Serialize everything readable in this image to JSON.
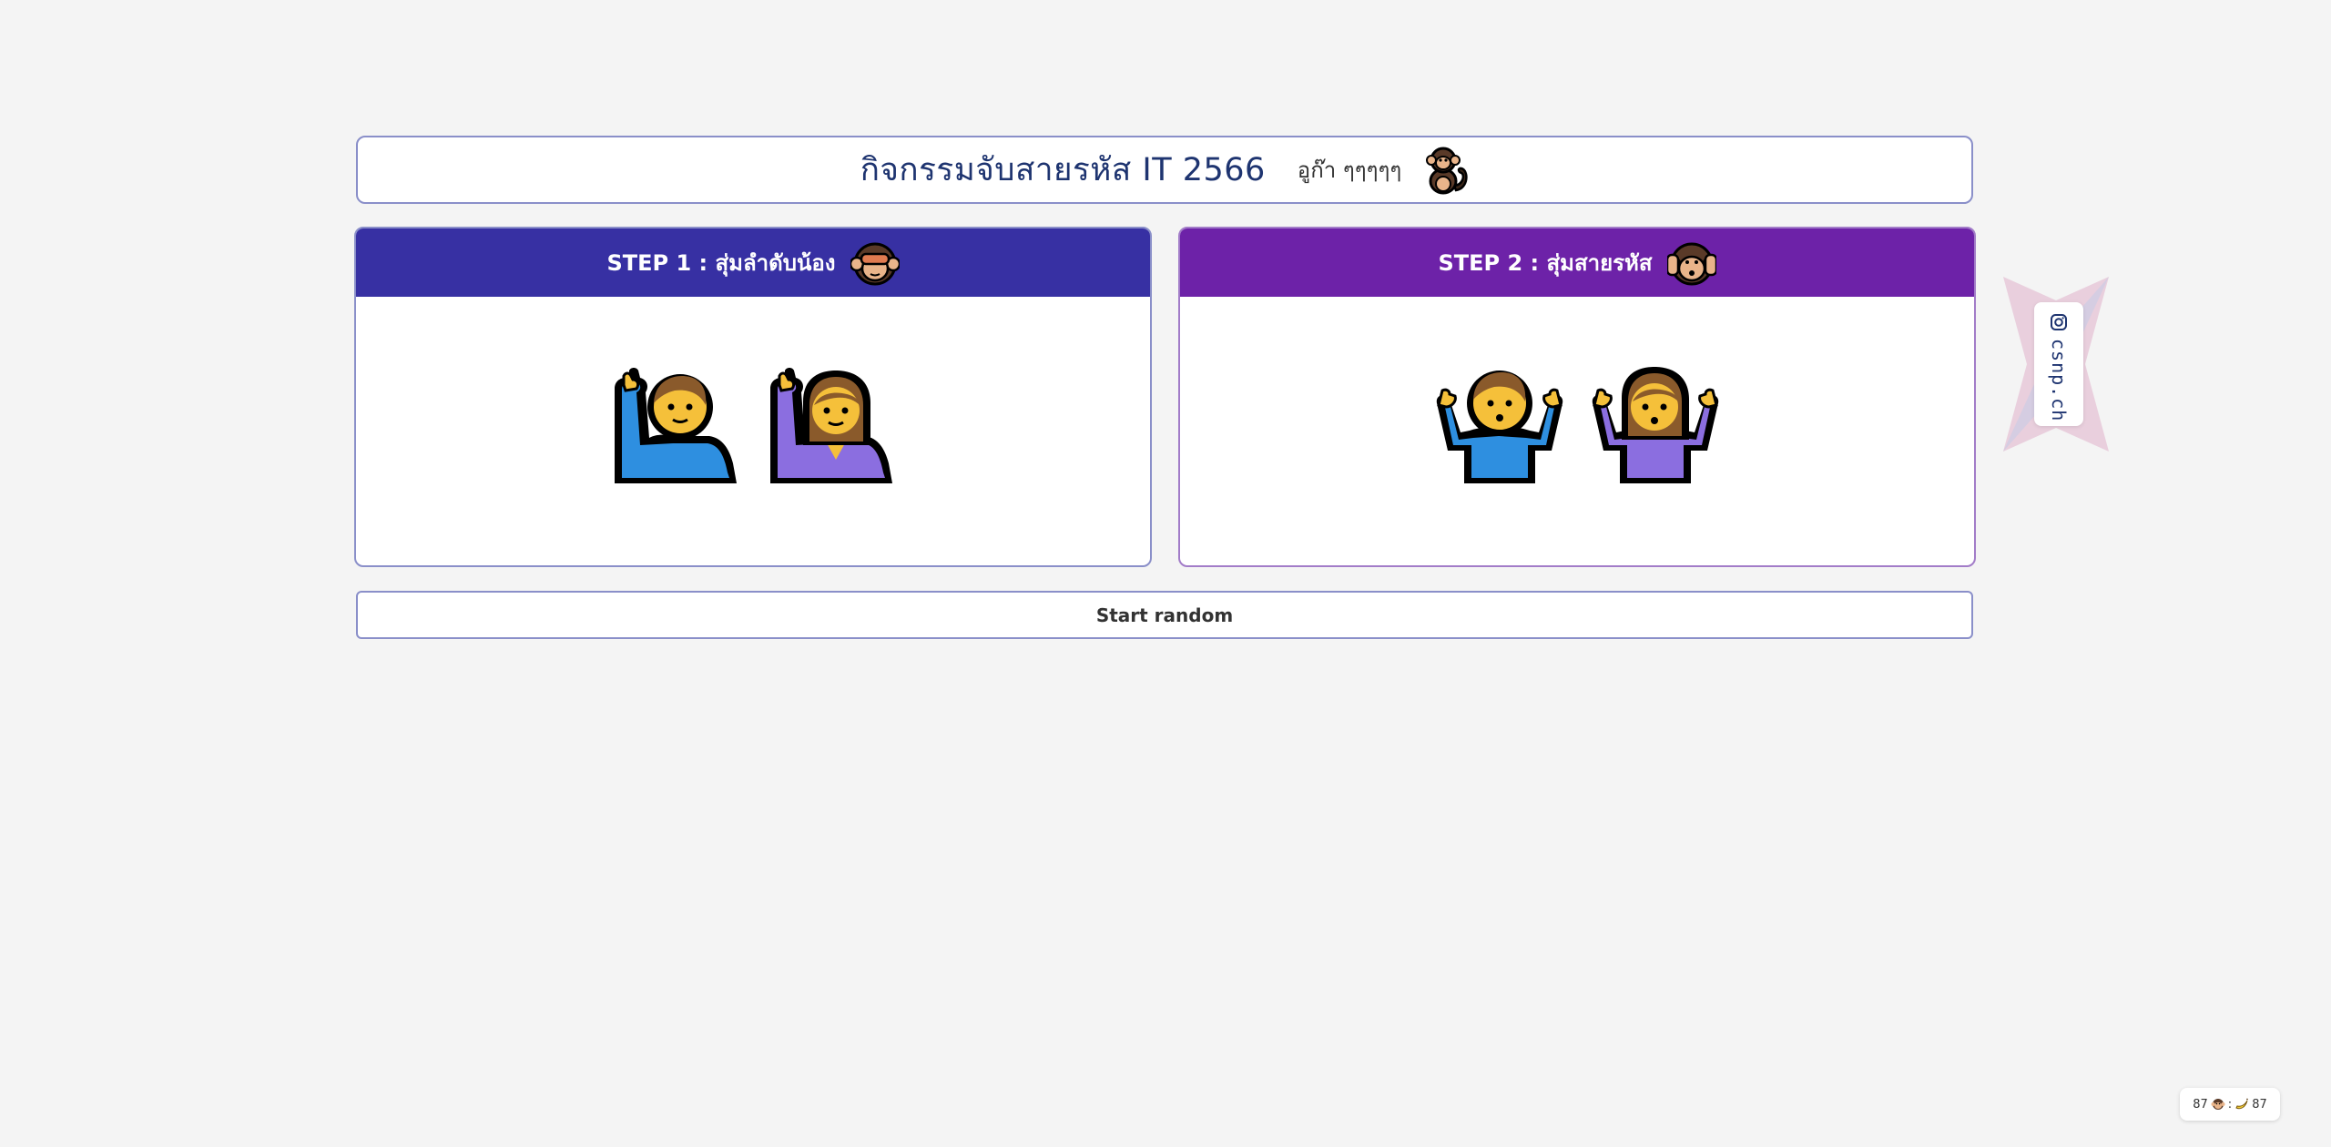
{
  "header": {
    "title": "กิจกรรมจับสายรหัส IT 2566",
    "subtitle": "อูก๊า ๆๆๆๆๆ",
    "icon": "monkey-icon"
  },
  "steps": [
    {
      "label": "STEP 1 : สุ่มลำดับน้อง",
      "icon": "see-no-evil-monkey-icon",
      "color": "#3730a3",
      "people": [
        "man-raising-hand-icon",
        "woman-raising-hand-icon"
      ]
    },
    {
      "label": "STEP 2 : สุ่มสายรหัส",
      "icon": "hear-no-evil-monkey-icon",
      "color": "#6d22a8",
      "people": [
        "man-shrugging-icon",
        "woman-shrugging-icon"
      ]
    }
  ],
  "start_button": {
    "label": "Start random"
  },
  "social": {
    "handle": "csnp.ch",
    "icon": "instagram-icon"
  },
  "counter": {
    "left": "87",
    "separator": ":",
    "right": "87",
    "left_icon": "monkey-face-icon",
    "right_icon": "banana-icon"
  }
}
